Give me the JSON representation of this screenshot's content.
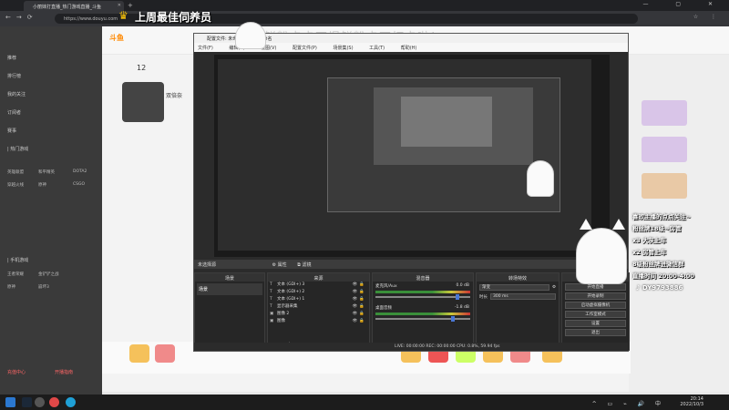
{
  "browser": {
    "tab_title": "小丽妹打直播_热门游戏直播_斗鱼",
    "address": "https://www.douyu.com",
    "new_tab_glyph": "+",
    "window_controls": "—  ▢  ✕"
  },
  "banner": {
    "text": "上周最佳伺养员"
  },
  "marquee": {
    "text": "鲜粉卡卡石塌鲜粉卡石打卡啦！"
  },
  "page": {
    "logo": "斗鱼",
    "follow_count": "12",
    "streamer_name": "双倍奈",
    "sidebar_items": [
      "推荐",
      "排行榜",
      "我的关注",
      "订阅者",
      "赛事"
    ],
    "sidebar_section_a": "|  热门游戏",
    "sidebar_grid_a": [
      "英雄联盟",
      "和平精英",
      "DOTA2",
      "穿越火线",
      "原神",
      "CSGO"
    ],
    "sidebar_section_b": "|  手机游戏",
    "sidebar_grid_b": [
      "王者荣耀",
      "金铲铲之战",
      "原神",
      "崩坏3"
    ],
    "sidebar_bottom": [
      "充值中心",
      "开播指南"
    ]
  },
  "obs": {
    "window_title": "配置文件: 未命名 - 场景: 未命名",
    "menu": [
      "文件(F)",
      "编辑(E)",
      "视图(V)",
      "配置文件(P)",
      "场景集(S)",
      "工具(T)",
      "帮助(H)"
    ],
    "toolbar_label": "未选择源",
    "toolbar_buttons": [
      "⚙ 属性",
      "⧉ 滤镜"
    ],
    "docks": {
      "scenes": {
        "header": "场景",
        "items": [
          "场景"
        ]
      },
      "sources": {
        "header": "来源",
        "items": [
          {
            "type": "T",
            "name": "文本 (GDI+) 3"
          },
          {
            "type": "T",
            "name": "文本 (GDI+) 2"
          },
          {
            "type": "T",
            "name": "文本 (GDI+) 1"
          },
          {
            "type": "T",
            "name": "显示器采集"
          },
          {
            "type": "▣",
            "name": "图像 2"
          },
          {
            "type": "▣",
            "name": "图像"
          }
        ]
      },
      "mixer": {
        "header": "混音器",
        "channels": [
          {
            "name": "麦克风/Aux",
            "db": "0.0 dB",
            "fader": 0.85
          },
          {
            "name": "桌面音频",
            "db": "-1.8 dB",
            "fader": 0.8
          }
        ]
      },
      "transitions": {
        "header": "转场特效",
        "type_value": "渐变",
        "duration_label": "时长",
        "duration_value": "300 ms"
      },
      "controls": {
        "header": "控件",
        "buttons": [
          "开始直播",
          "开始录制",
          "启动虚拟摄像机",
          "工作室模式",
          "设置",
          "退出"
        ]
      }
    },
    "status": "LIVE: 00:00:00    REC: 00:00:00    CPU: 0.8%, 59.94 fps"
  },
  "overlay": {
    "rules_title": "喜欢主播的点点关注~",
    "rules": [
      "粉丝牌18级~房管",
      "x3 大灰上车",
      "x2 房管上车",
      "8级粉丝牌进微信群",
      "直播时间 20:00-4:00"
    ],
    "tiktok_id": "DY9793886"
  },
  "taskbar": {
    "time": "20:14",
    "date": "2022/10/3",
    "tray_icons": "^  ▭  ⌁  🔊  中"
  }
}
